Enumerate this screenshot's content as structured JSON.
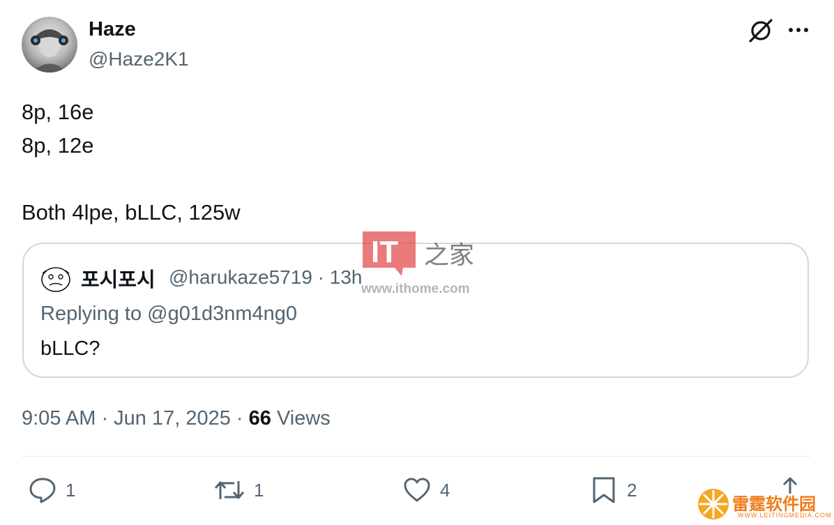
{
  "author": {
    "name": "Haze",
    "handle": "@Haze2K1"
  },
  "header_icons": [
    "grok-icon",
    "more-icon"
  ],
  "tweet": {
    "lines": [
      "8p, 16e",
      "8p, 12e",
      "",
      "Both 4lpe, bLLC, 125w"
    ]
  },
  "quoted": {
    "name": "포시포시",
    "handle_time": "@harukaze5719 · 13h",
    "replying_to": "Replying to @g01d3nm4ng0",
    "text": "bLLC?"
  },
  "meta": {
    "time_date": "9:05 AM · Jun 17, 2025 · ",
    "views_count": "66",
    "views_label": " Views"
  },
  "actions": {
    "replies": "1",
    "reposts": "1",
    "likes": "4",
    "bookmarks": "2"
  },
  "watermarks": {
    "it_text": "IT",
    "it_chinese": "之家",
    "url": "www.ithome.com",
    "right_text": "雷霆软件园",
    "right_sub": "WWW.LEITINGMEDIA.COM"
  },
  "colors": {
    "text_primary": "#0f1419",
    "text_secondary": "#536471",
    "border": "#cfd9de",
    "it_red": "#e04848",
    "orange": "#f07c1a"
  }
}
